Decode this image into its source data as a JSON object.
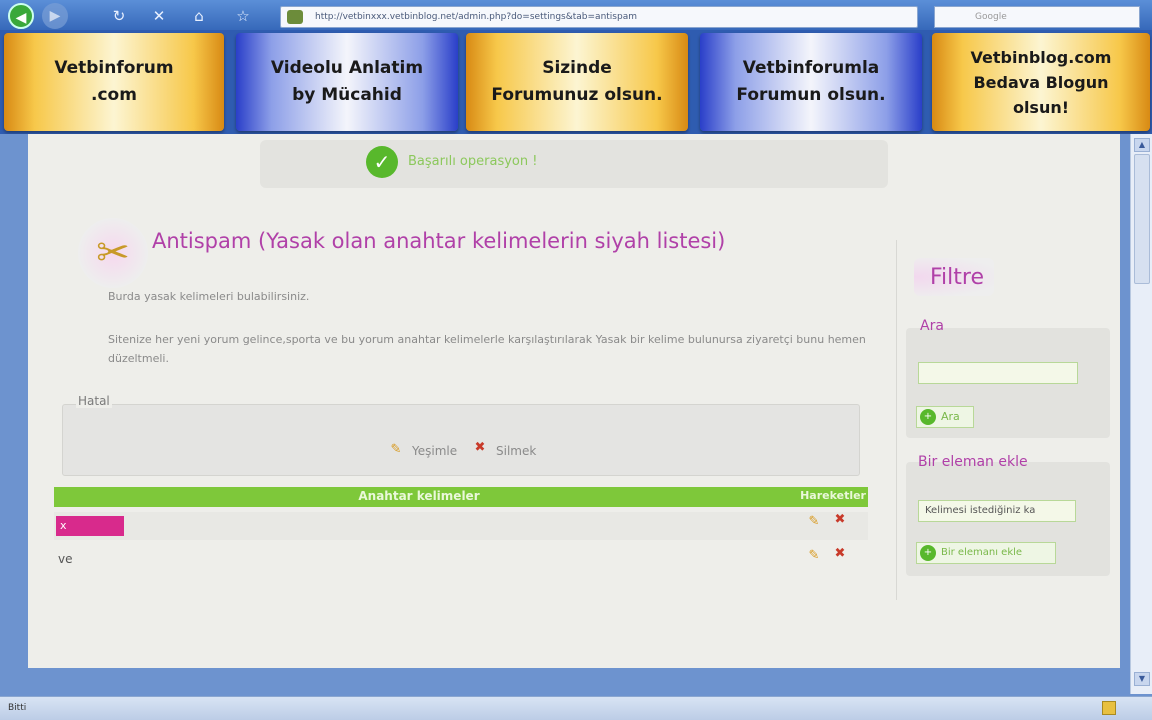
{
  "browser": {
    "url": "http://vetbinxxx.vetbinblog.net/admin.php?do=settings&tab=antispam",
    "search_placeholder": "Google",
    "status": "Bitti"
  },
  "banners": [
    {
      "text": "Vetbinforum\n.com",
      "style": "gold"
    },
    {
      "text": "Videolu Anlatim\nby Mücahid",
      "style": "blue"
    },
    {
      "text": "Sizinde\nForumunuz olsun.",
      "style": "gold"
    },
    {
      "text": "Vetbinforumla\nForumun olsun.",
      "style": "blue"
    },
    {
      "text": "Vetbinblog.com\nBedava Blogun\nolsun!",
      "style": "gold"
    }
  ],
  "success": {
    "message": "Başarılı operasyon !"
  },
  "page": {
    "title": "Antispam (Yasak olan anahtar kelimelerin siyah listesi)",
    "description": "Burda yasak kelimeleri bulabilirsiniz.",
    "info": "Sitenize her yeni yorum gelince,sporta ve bu yorum anahtar kelimelerle karşılaştırılarak Yasak bir kelime bulunursa ziyaretçi bunu hemen düzeltmeli."
  },
  "legend": {
    "title": "Hatal",
    "edit_label": "Yeşimle",
    "delete_label": "Silmek"
  },
  "table": {
    "header_keywords": "Anahtar kelimeler",
    "header_actions": "Hareketler",
    "rows": [
      {
        "keyword": "x"
      },
      {
        "keyword": "ve"
      }
    ]
  },
  "sidebar": {
    "filter_title": "Filtre",
    "search_label": "Ara",
    "search_value": "",
    "search_button": "Ara",
    "add_label": "Bir eleman ekle",
    "add_value": "Kelimesi istediğiniz ka",
    "add_button": "Bir elemanı ekle"
  }
}
